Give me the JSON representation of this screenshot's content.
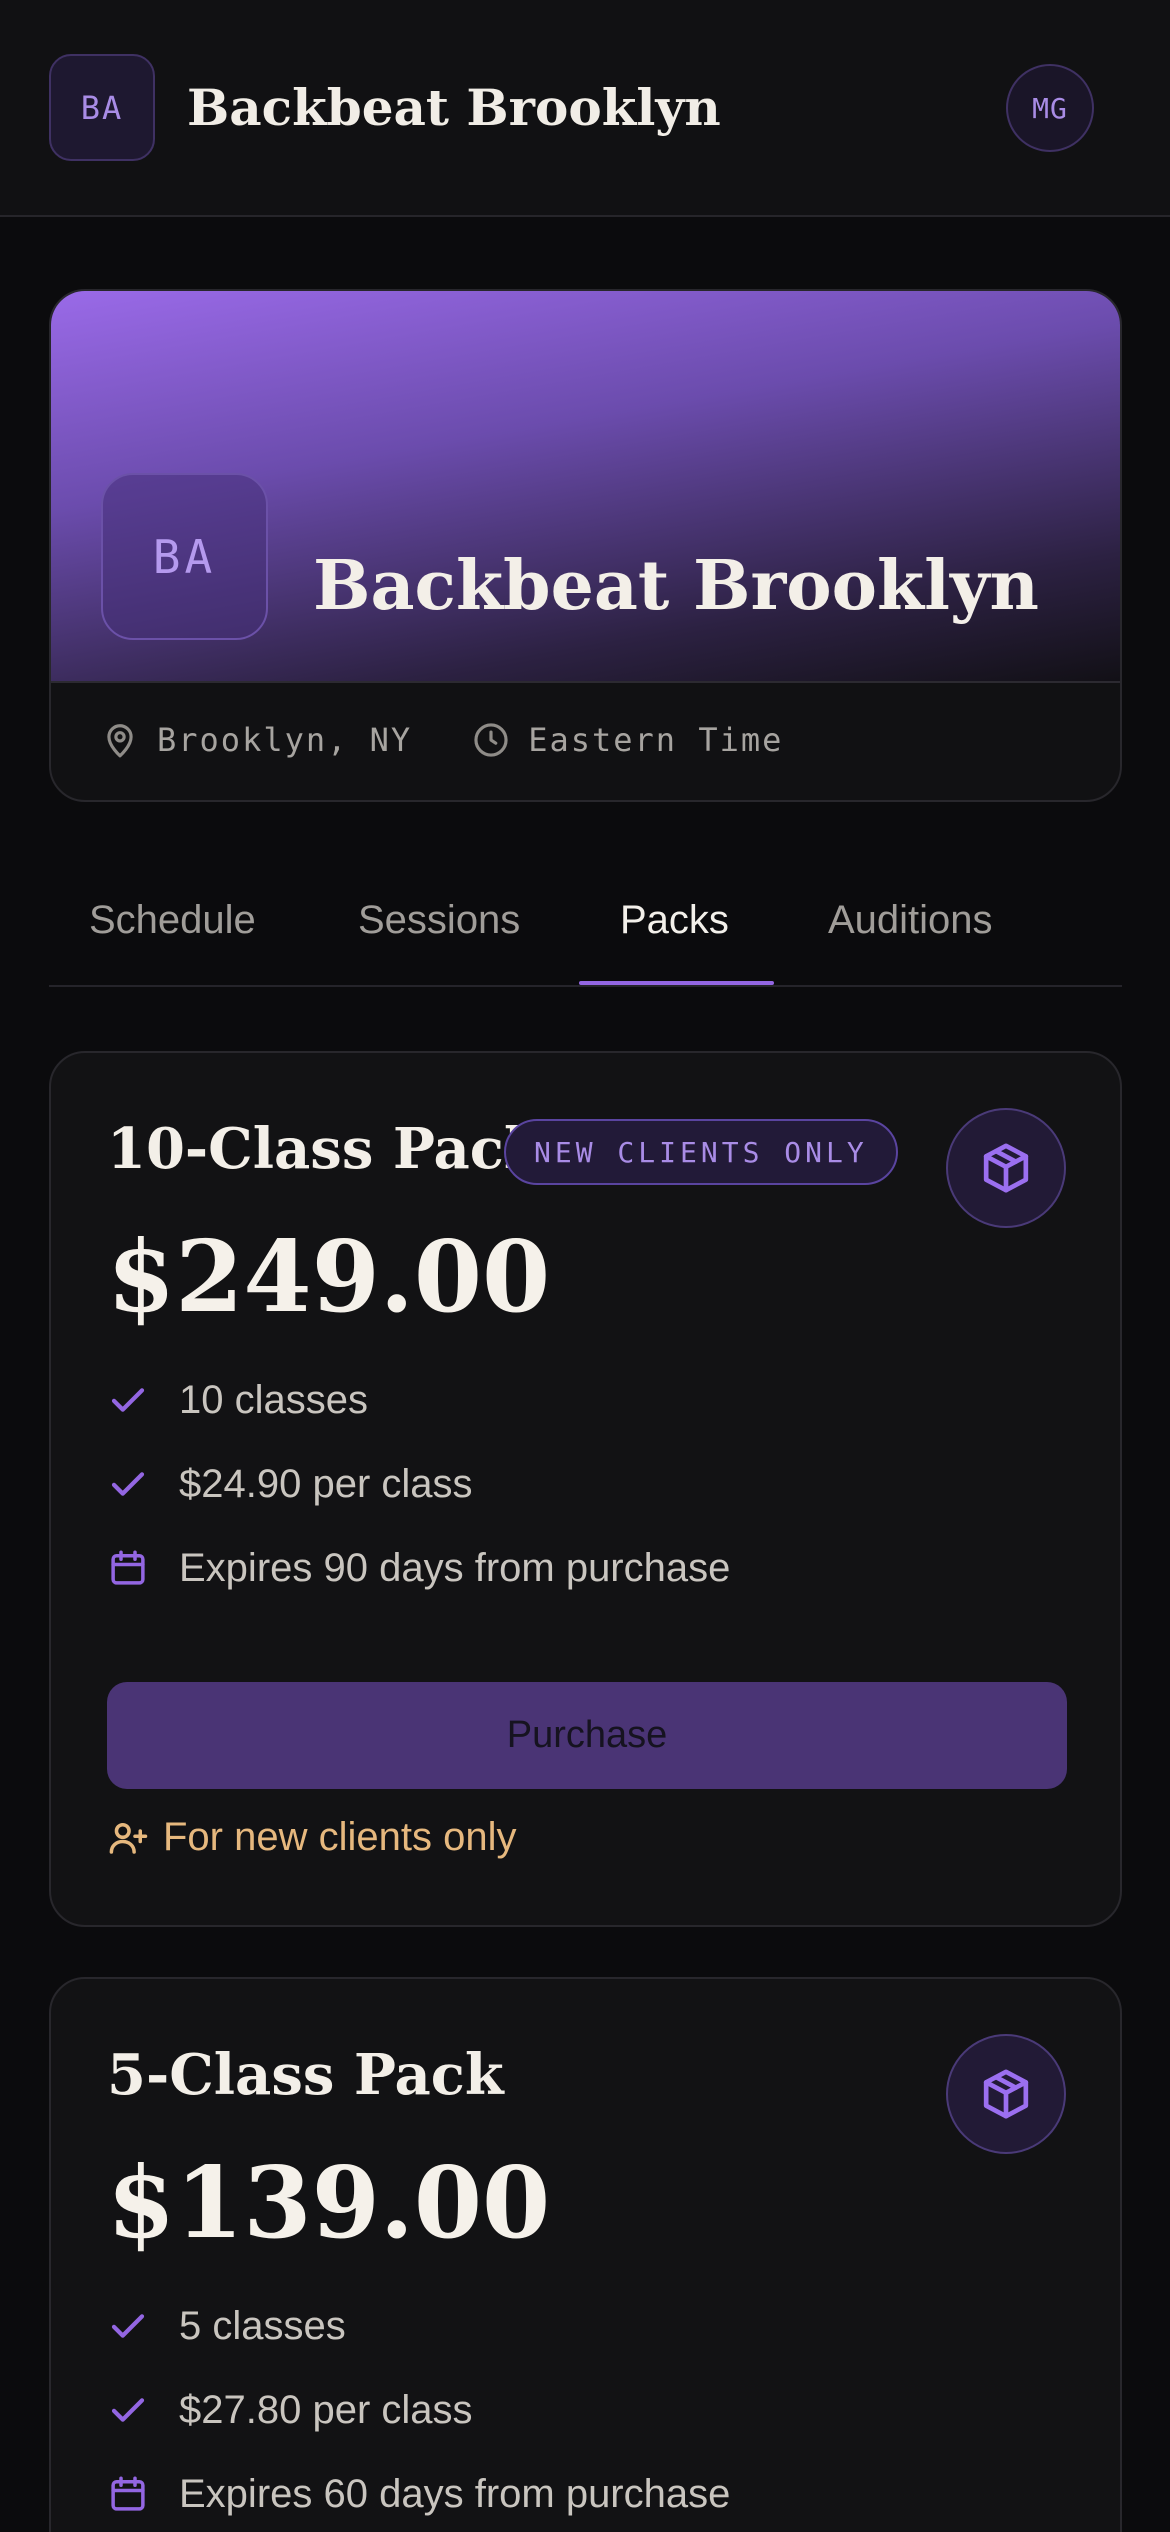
{
  "header": {
    "badge_initials": "BA",
    "title": "Backbeat Brooklyn",
    "avatar_initials": "MG"
  },
  "hero": {
    "badge_initials": "BA",
    "name": "Backbeat Brooklyn",
    "location": "Brooklyn, NY",
    "timezone": "Eastern Time",
    "location_icon": "map-pin-icon",
    "timezone_icon": "clock-icon"
  },
  "tabs": [
    {
      "label": "Schedule",
      "active": false
    },
    {
      "label": "Sessions",
      "active": false
    },
    {
      "label": "Packs",
      "active": true
    },
    {
      "label": "Auditions",
      "active": false
    }
  ],
  "packs": [
    {
      "title": "10-Class Pack",
      "tag": "NEW CLIENTS ONLY",
      "price": "$249.00",
      "features": [
        {
          "icon": "check-icon",
          "text": "10 classes"
        },
        {
          "icon": "check-icon",
          "text": "$24.90 per class"
        },
        {
          "icon": "calendar-icon",
          "text": "Expires 90 days from purchase"
        }
      ],
      "button_label": "Purchase",
      "restriction_icon": "user-plus-icon",
      "restriction": "For new clients only"
    },
    {
      "title": "5-Class Pack",
      "price": "$139.00",
      "features": [
        {
          "icon": "check-icon",
          "text": "5 classes"
        },
        {
          "icon": "check-icon",
          "text": "$27.80 per class"
        },
        {
          "icon": "calendar-icon",
          "text": "Expires 60 days from purchase"
        }
      ]
    }
  ],
  "colors": {
    "background": "#0b0b0d",
    "surface": "#121214",
    "accent": "#9366e2",
    "accent_muted": "#4a3475",
    "warning_text": "#e6b87e"
  }
}
